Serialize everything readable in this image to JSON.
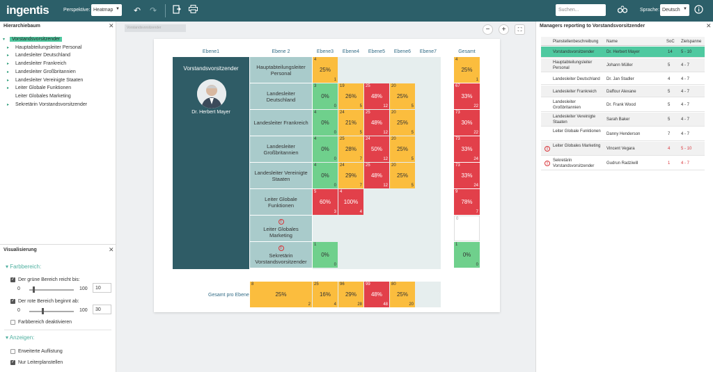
{
  "topbar": {
    "logo": "ingentis",
    "perspective_label": "Perspektive:",
    "perspective_value": "Heatmap",
    "search_placeholder": "Suchen...",
    "language_label": "Sprache:",
    "language_value": "Deutsch"
  },
  "hierarchy": {
    "title": "Hierarchiebaum",
    "items": [
      {
        "label": "Vorstandsvorsitzender"
      },
      {
        "label": "Hauptabteilungsleiter Personal"
      },
      {
        "label": "Landesleiter Deutschland"
      },
      {
        "label": "Landesleiter Frankreich"
      },
      {
        "label": "Landesleiter Großbritannien"
      },
      {
        "label": "Landesleiter Vereinigte Staaten"
      },
      {
        "label": "Leiter Globale Funktionen"
      },
      {
        "label": "Leiter Globales Marketing"
      },
      {
        "label": "Sekretärin Vorstandsvorsitzender"
      }
    ]
  },
  "visualization": {
    "title": "Visualisierung",
    "section_color": "Farbbereich:",
    "green_label": "Der grüne Bereich reicht bis:",
    "green_min": "0",
    "green_max": "100",
    "green_value": "10",
    "red_label": "Der rote Bereich beginnt ab:",
    "red_min": "0",
    "red_max": "100",
    "red_value": "30",
    "disable_label": "Farbbereich deaktivieren",
    "section_show": "Anzeigen:",
    "extended_label": "Erweiterte Auflistung",
    "leaders_label": "Nur Leiterplanstellen"
  },
  "breadcrumb": "Vorstandsvorsitzender",
  "heatmap": {
    "columns": [
      "Ebene1",
      "Ebene 2",
      "Ebene3",
      "Ebene4",
      "Ebene5",
      "Ebene6",
      "Ebene7",
      "Gesamt"
    ],
    "level1_title": "Vorstandsvorsitzender",
    "level1_person": "Dr. Herbert Mayer",
    "rows": [
      {
        "label": "Hauptabteilungsleiter Personal",
        "cells": [
          {
            "tl": "4",
            "ctr": "25%",
            "br": "1",
            "c": "y"
          }
        ],
        "total": {
          "tl": "4",
          "ctr": "25%",
          "br": "1",
          "c": "y"
        }
      },
      {
        "label": "Landesleiter Deutschland",
        "cells": [
          {
            "tl": "3",
            "ctr": "0%",
            "br": "0",
            "c": "g"
          },
          {
            "tl": "19",
            "ctr": "26%",
            "br": "5",
            "c": "y"
          },
          {
            "tl": "25",
            "ctr": "48%",
            "br": "12",
            "c": "r"
          },
          {
            "tl": "20",
            "ctr": "25%",
            "br": "5",
            "c": "y"
          }
        ],
        "total": {
          "tl": "67",
          "ctr": "33%",
          "br": "22",
          "c": "r"
        }
      },
      {
        "label": "Landesleiter Frankreich",
        "cells": [
          {
            "tl": "4",
            "ctr": "0%",
            "br": "0",
            "c": "g"
          },
          {
            "tl": "24",
            "ctr": "21%",
            "br": "5",
            "c": "y"
          },
          {
            "tl": "25",
            "ctr": "48%",
            "br": "12",
            "c": "r"
          },
          {
            "tl": "20",
            "ctr": "25%",
            "br": "5",
            "c": "y"
          }
        ],
        "total": {
          "tl": "73",
          "ctr": "30%",
          "br": "22",
          "c": "r"
        }
      },
      {
        "label": "Landesleiter Großbritannien",
        "cells": [
          {
            "tl": "4",
            "ctr": "0%",
            "br": "0",
            "c": "g"
          },
          {
            "tl": "25",
            "ctr": "28%",
            "br": "7",
            "c": "y"
          },
          {
            "tl": "24",
            "ctr": "50%",
            "br": "12",
            "c": "r"
          },
          {
            "tl": "20",
            "ctr": "25%",
            "br": "5",
            "c": "y"
          }
        ],
        "total": {
          "tl": "73",
          "ctr": "33%",
          "br": "24",
          "c": "r"
        }
      },
      {
        "label": "Landesleiter Vereinigte Staaten",
        "cells": [
          {
            "tl": "4",
            "ctr": "0%",
            "br": "0",
            "c": "g"
          },
          {
            "tl": "24",
            "ctr": "29%",
            "br": "7",
            "c": "y"
          },
          {
            "tl": "25",
            "ctr": "48%",
            "br": "12",
            "c": "r"
          },
          {
            "tl": "20",
            "ctr": "25%",
            "br": "5",
            "c": "y"
          }
        ],
        "total": {
          "tl": "73",
          "ctr": "33%",
          "br": "24",
          "c": "r"
        }
      },
      {
        "label": "Leiter Globale Funktionen",
        "cells": [
          {
            "tl": "5",
            "ctr": "60%",
            "br": "3",
            "c": "r"
          },
          {
            "tl": "4",
            "ctr": "100%",
            "br": "4",
            "c": "r"
          }
        ],
        "total": {
          "tl": "9",
          "ctr": "78%",
          "br": "7",
          "c": "r"
        }
      },
      {
        "label": "Leiter Globales Marketing",
        "warn": true,
        "cells": [],
        "total": {
          "tl": "0",
          "ctr": "",
          "br": "",
          "c": "w"
        }
      },
      {
        "label": "Sekretärin Vorstandsvorsitzender",
        "warn": true,
        "cells": [
          {
            "tl": "1",
            "ctr": "0%",
            "br": "0",
            "c": "g"
          }
        ],
        "total": {
          "tl": "1",
          "ctr": "0%",
          "br": "0",
          "c": "g"
        }
      }
    ],
    "total_label": "Gesamt pro Ebene",
    "totals": [
      {
        "tl": "8",
        "ctr": "25%",
        "br": "2",
        "c": "y"
      },
      {
        "tl": "25",
        "ctr": "16%",
        "br": "4",
        "c": "y"
      },
      {
        "tl": "96",
        "ctr": "29%",
        "br": "28",
        "c": "y"
      },
      {
        "tl": "99",
        "ctr": "48%",
        "br": "48",
        "c": "r"
      },
      {
        "tl": "80",
        "ctr": "25%",
        "br": "20",
        "c": "y"
      }
    ]
  },
  "colors": {
    "green": "#6fd08c",
    "yellow": "#fbbd3e",
    "red": "#e2404a",
    "teal": "#2c5f69",
    "selected": "#4fc9a0"
  },
  "managers": {
    "title": "Managers reporting to Vorstandsvorsitzender",
    "headers": [
      "Planstellenbeschreibung",
      "Name",
      "SoC",
      "Zielspanne"
    ],
    "rows": [
      {
        "desc": "Vorstandsvorsitzender",
        "name": "Dr. Herbert Mayer",
        "soc": "14",
        "range": "5 - 10",
        "sel": true
      },
      {
        "desc": "Hauptabteilungsleiter Personal",
        "name": "Johann Müller",
        "soc": "5",
        "range": "4 - 7"
      },
      {
        "desc": "Landesleiter Deutschland",
        "name": "Dr. Jan Stadler",
        "soc": "4",
        "range": "4 - 7"
      },
      {
        "desc": "Landesleiter Frankreich",
        "name": "Daffour Alexane",
        "soc": "5",
        "range": "4 - 7"
      },
      {
        "desc": "Landesleiter Großbritannien",
        "name": "Dr. Frank Wood",
        "soc": "5",
        "range": "4 - 7"
      },
      {
        "desc": "Landesleiter Vereinigte Staaten",
        "name": "Sarah Baker",
        "soc": "5",
        "range": "4 - 7"
      },
      {
        "desc": "Leiter Globale Funktionen",
        "name": "Danny Henderson",
        "soc": "7",
        "range": "4 - 7"
      },
      {
        "desc": "Leiter Globales Marketing",
        "name": "Vincent Vegara",
        "soc": "4",
        "range": "5 - 10",
        "warn": true
      },
      {
        "desc": "Sekretärin Vorstandsvorsitzender",
        "name": "Gudrun Radziwill",
        "soc": "1",
        "range": "4 - 7",
        "warn": true
      }
    ]
  }
}
